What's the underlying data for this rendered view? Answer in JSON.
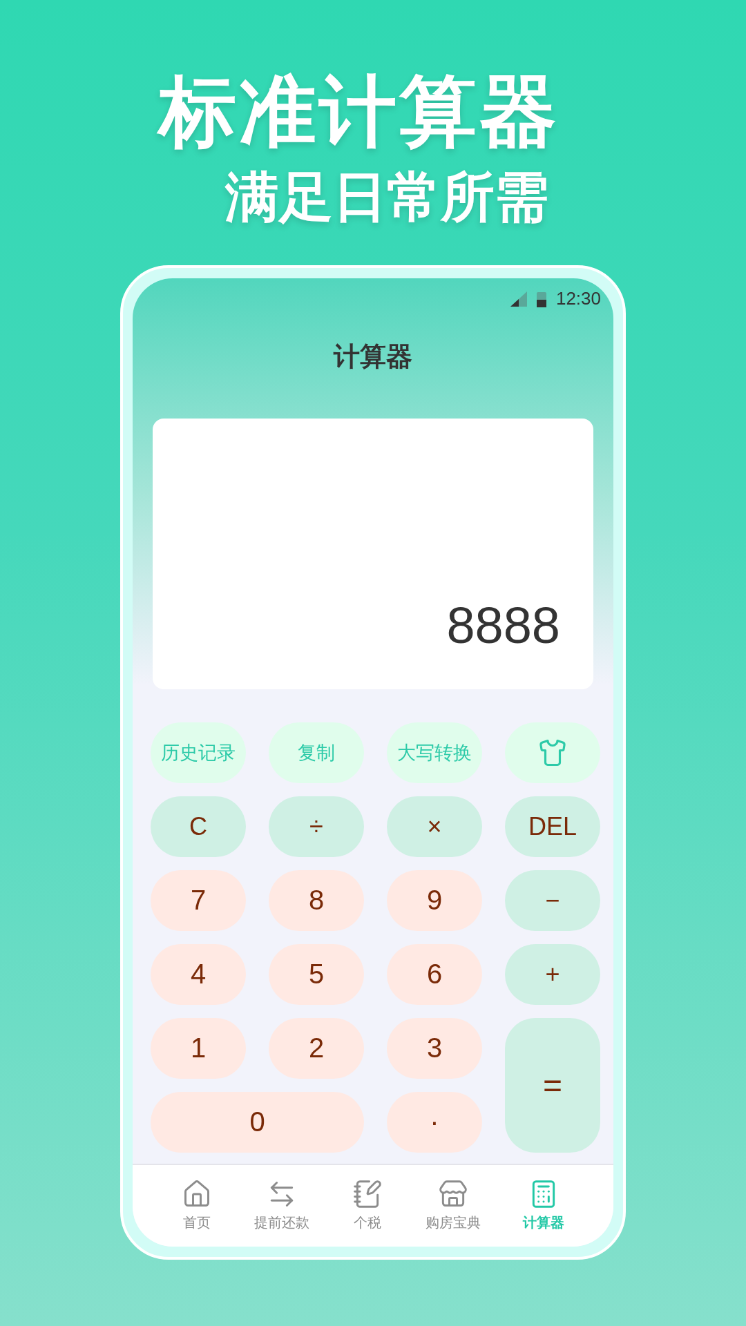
{
  "headline": "标准计算器",
  "subheadline": "满足日常所需",
  "status_bar": {
    "time": "12:30"
  },
  "title": "计算器",
  "display": {
    "value": "8888"
  },
  "tools": [
    {
      "kind": "text",
      "label": "历史记录"
    },
    {
      "kind": "text",
      "label": "复制"
    },
    {
      "kind": "text",
      "label": "大写转换"
    },
    {
      "kind": "skin"
    }
  ],
  "keys": [
    {
      "label": "C",
      "kind": "op"
    },
    {
      "label": "÷",
      "kind": "op"
    },
    {
      "label": "×",
      "kind": "op"
    },
    {
      "label": "DEL",
      "kind": "op"
    },
    {
      "label": "7",
      "kind": "digit"
    },
    {
      "label": "8",
      "kind": "digit"
    },
    {
      "label": "9",
      "kind": "digit"
    },
    {
      "label": "−",
      "kind": "op"
    },
    {
      "label": "4",
      "kind": "digit"
    },
    {
      "label": "5",
      "kind": "digit"
    },
    {
      "label": "6",
      "kind": "digit"
    },
    {
      "label": "+",
      "kind": "op"
    },
    {
      "label": "1",
      "kind": "digit"
    },
    {
      "label": "2",
      "kind": "digit"
    },
    {
      "label": "3",
      "kind": "digit"
    },
    {
      "label": "=",
      "kind": "equals"
    },
    {
      "label": "0",
      "kind": "zero"
    },
    {
      "label": "·",
      "kind": "digit"
    }
  ],
  "nav": [
    {
      "label": "首页",
      "selected": false
    },
    {
      "label": "提前还款",
      "selected": false
    },
    {
      "label": "个税",
      "selected": false
    },
    {
      "label": "购房宝典",
      "selected": false
    },
    {
      "label": "计算器",
      "selected": true
    }
  ]
}
